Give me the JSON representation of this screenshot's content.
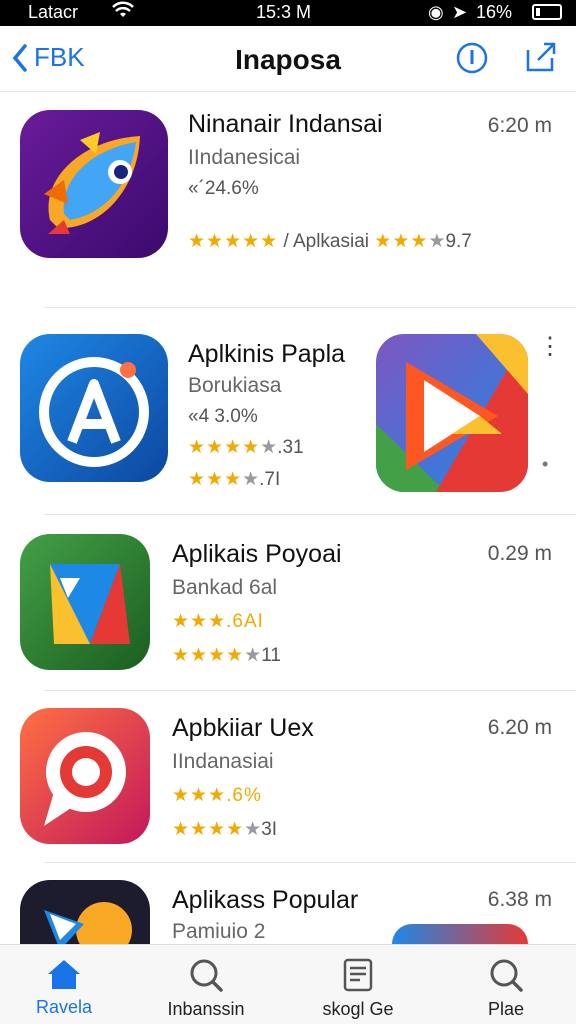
{
  "status": {
    "carrier": "Latacr",
    "time": "15:3 M",
    "battery_pct": "16%"
  },
  "nav": {
    "back_label": "FBK",
    "title": "Inaposa"
  },
  "apps": [
    {
      "title": "Ninanair Indansai",
      "subtitle": "IIndanesicai",
      "line1": "«´24.6%",
      "rating_suffix": "/ Aplkasiai",
      "rating_value": "9.7",
      "size": "6:20 m"
    },
    {
      "title": "Aplkinis Papla",
      "subtitle": "Borukiasa",
      "line1": "«4 3.0%",
      "rating1": ".31",
      "rating2": ".7I"
    },
    {
      "title": "Aplikais Poyoai",
      "subtitle": "Bankad 6al",
      "rating1": ".6AI",
      "rating2": "11",
      "size": "0.29 m"
    },
    {
      "title": "Apbkiiar Uex",
      "subtitle": "IIndanasiai",
      "rating1": ".6%",
      "rating2": "3I",
      "size": "6.20 m"
    },
    {
      "title": "Aplikass Popular",
      "subtitle": "Pamiuio  2",
      "size": "6.38 m"
    }
  ],
  "tabs": [
    {
      "label": "Ravela",
      "icon": "home-icon"
    },
    {
      "label": "Inbanssin",
      "icon": "search-icon"
    },
    {
      "label": "skogl Ge",
      "icon": "document-icon"
    },
    {
      "label": "Plae",
      "icon": "search-icon"
    }
  ],
  "colors": {
    "accent": "#1a73e8",
    "star": "#f2a900"
  }
}
